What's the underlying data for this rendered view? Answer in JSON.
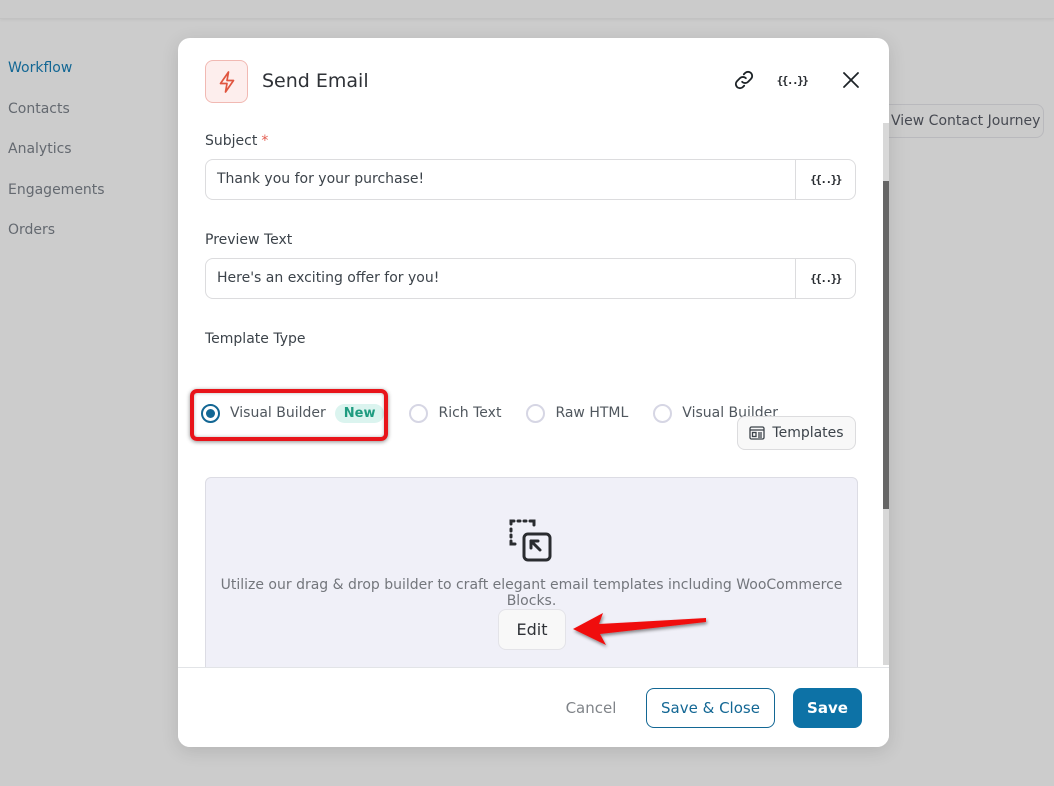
{
  "sidebar": {
    "items": [
      {
        "label": "Workflow",
        "active": true
      },
      {
        "label": "Contacts"
      },
      {
        "label": "Analytics"
      },
      {
        "label": "Engagements"
      },
      {
        "label": "Orders"
      }
    ]
  },
  "background": {
    "view_contact_journey_label": "View Contact Journey"
  },
  "modal": {
    "title": "Send Email",
    "icons": {
      "header_icon": "lightning-bolt-icon",
      "link": "link-icon",
      "merge_tags": "merge-tags-icon",
      "close": "close-icon"
    },
    "merge_tag_glyph": "{{..}}",
    "subject": {
      "label": "Subject",
      "required_mark": "*",
      "value": "Thank you for your purchase!"
    },
    "preview_text": {
      "label": "Preview Text",
      "value": "Here's an exciting offer for you!"
    },
    "template_type": {
      "label": "Template Type",
      "options": [
        {
          "label": "Visual Builder",
          "badge": "New",
          "checked": true
        },
        {
          "label": "Rich Text",
          "checked": false
        },
        {
          "label": "Raw HTML",
          "checked": false
        },
        {
          "label": "Visual Builder",
          "checked": false
        }
      ]
    },
    "templates_button": "Templates",
    "builder": {
      "description": "Utilize our drag & drop builder to craft elegant email templates including WooCommerce Blocks.",
      "edit_button": "Edit"
    },
    "footer": {
      "cancel": "Cancel",
      "save_close": "Save & Close",
      "save": "Save"
    }
  },
  "annotations": {
    "highlight_color": "#e8141a",
    "arrow_color": "#e8141a"
  },
  "colors": {
    "primary": "#136794",
    "save_bg": "#0d72a6",
    "badge_bg": "#dbf4ef",
    "badge_text": "#1f9c80"
  }
}
